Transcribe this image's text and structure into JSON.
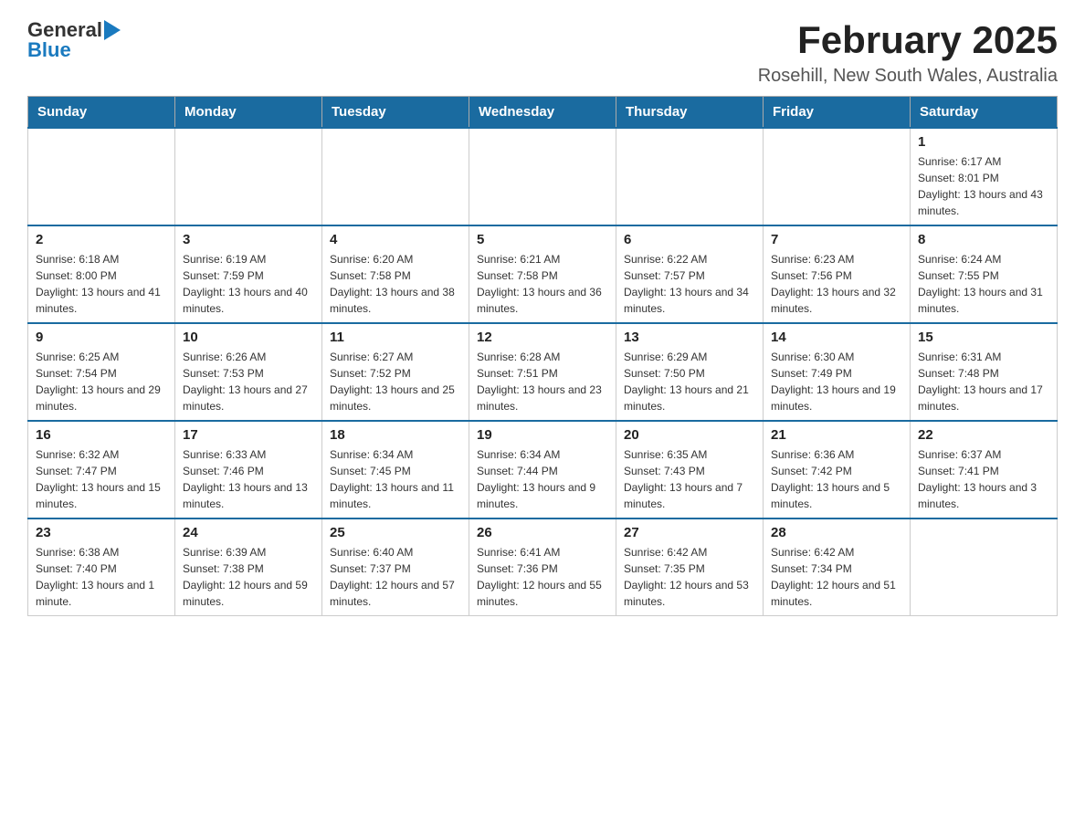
{
  "header": {
    "logo_general": "General",
    "logo_blue": "Blue",
    "month_title": "February 2025",
    "location": "Rosehill, New South Wales, Australia"
  },
  "weekdays": [
    "Sunday",
    "Monday",
    "Tuesday",
    "Wednesday",
    "Thursday",
    "Friday",
    "Saturday"
  ],
  "weeks": [
    [
      {
        "day": "",
        "info": ""
      },
      {
        "day": "",
        "info": ""
      },
      {
        "day": "",
        "info": ""
      },
      {
        "day": "",
        "info": ""
      },
      {
        "day": "",
        "info": ""
      },
      {
        "day": "",
        "info": ""
      },
      {
        "day": "1",
        "info": "Sunrise: 6:17 AM\nSunset: 8:01 PM\nDaylight: 13 hours and 43 minutes."
      }
    ],
    [
      {
        "day": "2",
        "info": "Sunrise: 6:18 AM\nSunset: 8:00 PM\nDaylight: 13 hours and 41 minutes."
      },
      {
        "day": "3",
        "info": "Sunrise: 6:19 AM\nSunset: 7:59 PM\nDaylight: 13 hours and 40 minutes."
      },
      {
        "day": "4",
        "info": "Sunrise: 6:20 AM\nSunset: 7:58 PM\nDaylight: 13 hours and 38 minutes."
      },
      {
        "day": "5",
        "info": "Sunrise: 6:21 AM\nSunset: 7:58 PM\nDaylight: 13 hours and 36 minutes."
      },
      {
        "day": "6",
        "info": "Sunrise: 6:22 AM\nSunset: 7:57 PM\nDaylight: 13 hours and 34 minutes."
      },
      {
        "day": "7",
        "info": "Sunrise: 6:23 AM\nSunset: 7:56 PM\nDaylight: 13 hours and 32 minutes."
      },
      {
        "day": "8",
        "info": "Sunrise: 6:24 AM\nSunset: 7:55 PM\nDaylight: 13 hours and 31 minutes."
      }
    ],
    [
      {
        "day": "9",
        "info": "Sunrise: 6:25 AM\nSunset: 7:54 PM\nDaylight: 13 hours and 29 minutes."
      },
      {
        "day": "10",
        "info": "Sunrise: 6:26 AM\nSunset: 7:53 PM\nDaylight: 13 hours and 27 minutes."
      },
      {
        "day": "11",
        "info": "Sunrise: 6:27 AM\nSunset: 7:52 PM\nDaylight: 13 hours and 25 minutes."
      },
      {
        "day": "12",
        "info": "Sunrise: 6:28 AM\nSunset: 7:51 PM\nDaylight: 13 hours and 23 minutes."
      },
      {
        "day": "13",
        "info": "Sunrise: 6:29 AM\nSunset: 7:50 PM\nDaylight: 13 hours and 21 minutes."
      },
      {
        "day": "14",
        "info": "Sunrise: 6:30 AM\nSunset: 7:49 PM\nDaylight: 13 hours and 19 minutes."
      },
      {
        "day": "15",
        "info": "Sunrise: 6:31 AM\nSunset: 7:48 PM\nDaylight: 13 hours and 17 minutes."
      }
    ],
    [
      {
        "day": "16",
        "info": "Sunrise: 6:32 AM\nSunset: 7:47 PM\nDaylight: 13 hours and 15 minutes."
      },
      {
        "day": "17",
        "info": "Sunrise: 6:33 AM\nSunset: 7:46 PM\nDaylight: 13 hours and 13 minutes."
      },
      {
        "day": "18",
        "info": "Sunrise: 6:34 AM\nSunset: 7:45 PM\nDaylight: 13 hours and 11 minutes."
      },
      {
        "day": "19",
        "info": "Sunrise: 6:34 AM\nSunset: 7:44 PM\nDaylight: 13 hours and 9 minutes."
      },
      {
        "day": "20",
        "info": "Sunrise: 6:35 AM\nSunset: 7:43 PM\nDaylight: 13 hours and 7 minutes."
      },
      {
        "day": "21",
        "info": "Sunrise: 6:36 AM\nSunset: 7:42 PM\nDaylight: 13 hours and 5 minutes."
      },
      {
        "day": "22",
        "info": "Sunrise: 6:37 AM\nSunset: 7:41 PM\nDaylight: 13 hours and 3 minutes."
      }
    ],
    [
      {
        "day": "23",
        "info": "Sunrise: 6:38 AM\nSunset: 7:40 PM\nDaylight: 13 hours and 1 minute."
      },
      {
        "day": "24",
        "info": "Sunrise: 6:39 AM\nSunset: 7:38 PM\nDaylight: 12 hours and 59 minutes."
      },
      {
        "day": "25",
        "info": "Sunrise: 6:40 AM\nSunset: 7:37 PM\nDaylight: 12 hours and 57 minutes."
      },
      {
        "day": "26",
        "info": "Sunrise: 6:41 AM\nSunset: 7:36 PM\nDaylight: 12 hours and 55 minutes."
      },
      {
        "day": "27",
        "info": "Sunrise: 6:42 AM\nSunset: 7:35 PM\nDaylight: 12 hours and 53 minutes."
      },
      {
        "day": "28",
        "info": "Sunrise: 6:42 AM\nSunset: 7:34 PM\nDaylight: 12 hours and 51 minutes."
      },
      {
        "day": "",
        "info": ""
      }
    ]
  ]
}
